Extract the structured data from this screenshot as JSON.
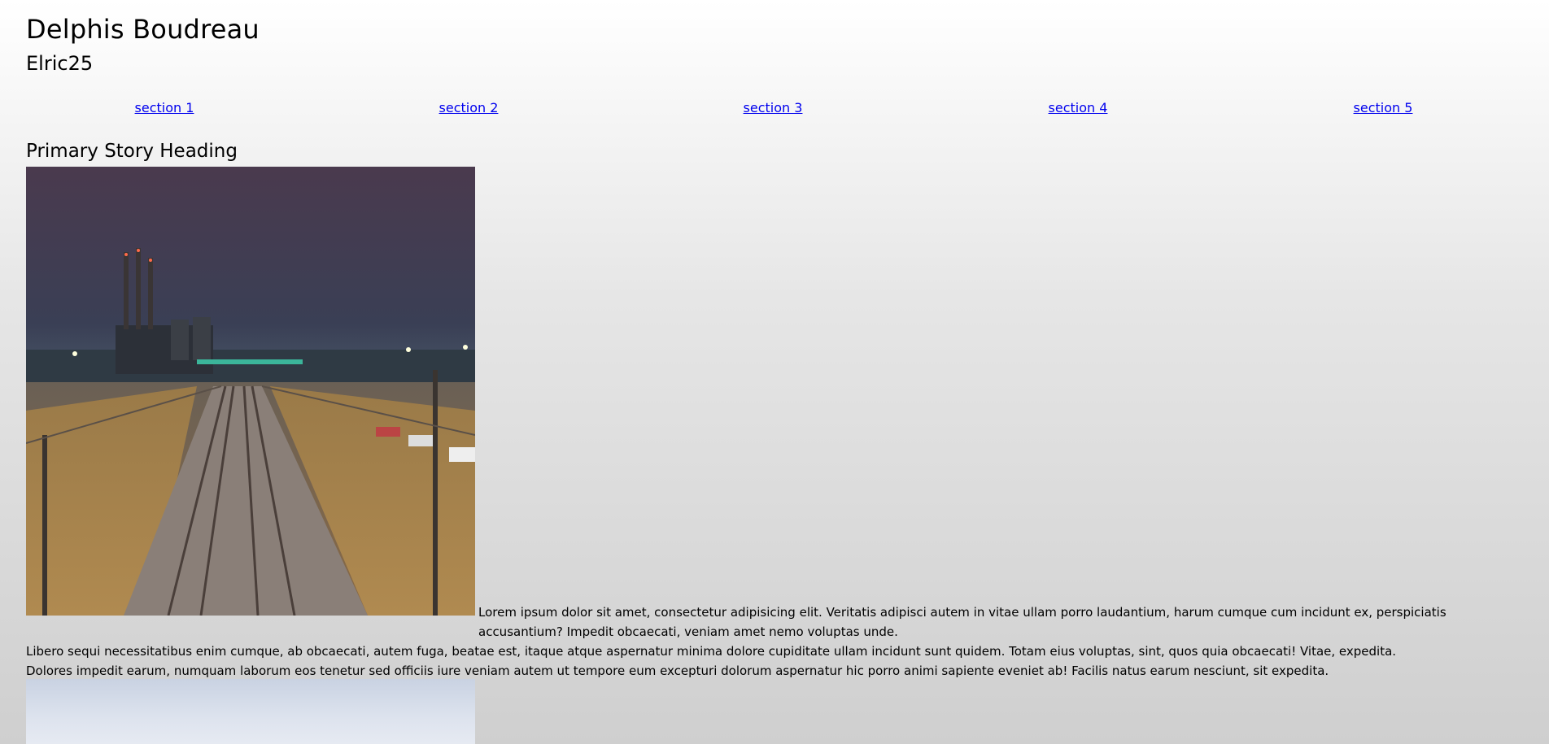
{
  "header": {
    "title": "Delphis Boudreau",
    "subtitle": "Elric25"
  },
  "nav": {
    "items": [
      {
        "label": "section 1"
      },
      {
        "label": "section 2"
      },
      {
        "label": "section 3"
      },
      {
        "label": "section 4"
      },
      {
        "label": "section 5"
      }
    ]
  },
  "story": {
    "heading": "Primary Story Heading",
    "image_alt": "night-railway-tracks-photo",
    "paragraph_1": "Lorem ipsum dolor sit amet, consectetur adipisicing elit. Veritatis adipisci autem in vitae ullam porro laudantium, harum cumque cum incidunt ex, perspiciatis accusantium? Impedit obcaecati, veniam amet nemo voluptas unde.",
    "paragraph_2": "Libero sequi necessitatibus enim cumque, ab obcaecati, autem fuga, beatae est, itaque atque aspernatur minima dolore cupiditate ullam incidunt sunt quidem. Totam eius voluptas, sint, quos quia obcaecati! Vitae, expedita.",
    "paragraph_3": "Dolores impedit earum, numquam laborum eos tenetur sed officiis iure veniam autem ut tempore eum excepturi dolorum aspernatur hic porro animi sapiente eveniet ab! Facilis natus earum nesciunt, sit expedita."
  }
}
